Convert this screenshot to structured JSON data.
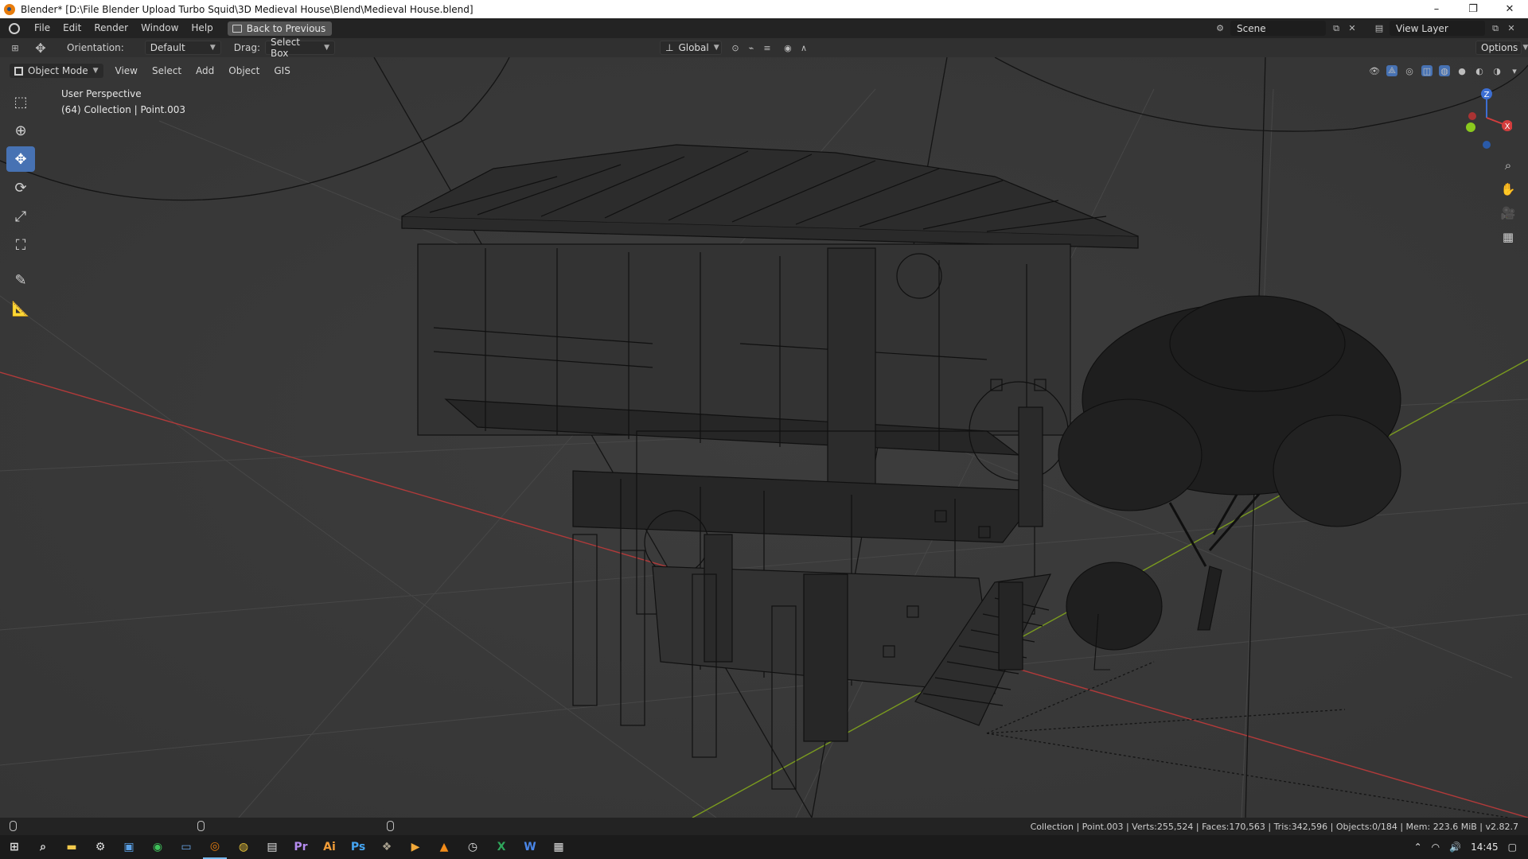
{
  "window": {
    "title": "Blender* [D:\\File Blender Upload Turbo Squid\\3D Medieval House\\Blend\\Medieval House.blend]",
    "minimize": "–",
    "maximize": "❐",
    "close": "✕"
  },
  "menu": {
    "items": [
      "File",
      "Edit",
      "Render",
      "Window",
      "Help"
    ],
    "back_button": "Back to Previous"
  },
  "scene": {
    "name": "Scene",
    "view_layer": "View Layer"
  },
  "tool_header": {
    "orientation_label": "Orientation:",
    "orientation_value": "Default",
    "drag_label": "Drag:",
    "drag_value": "Select Box",
    "transform_orientation": "Global",
    "options": "Options"
  },
  "view_header": {
    "mode": "Object Mode",
    "menus": [
      "View",
      "Select",
      "Add",
      "Object",
      "GIS"
    ]
  },
  "viewport": {
    "perspective": "User Perspective",
    "collection_info": "(64) Collection | Point.003",
    "axis_x": "X",
    "axis_y": "Y",
    "axis_z": "Z"
  },
  "status": {
    "text": "Collection | Point.003 | Verts:255,524 | Faces:170,563 | Tris:342,596 | Objects:0/184 | Mem: 223.6 MiB | v2.82.7"
  },
  "taskbar": {
    "apps": [
      "start-icon",
      "search-icon",
      "file-explorer-icon",
      "settings-icon",
      "calculator-icon",
      "whatsapp-icon",
      "taskview-icon",
      "blender-icon",
      "chrome-icon",
      "terminal-icon",
      "premiere-icon",
      "illustrator-icon",
      "photoshop-icon",
      "gimp-icon",
      "media-icon",
      "vlc-icon",
      "clock-icon",
      "excel-icon",
      "word-icon",
      "network-icon"
    ],
    "labels": {
      "premiere": "Pr",
      "illustrator": "Ai",
      "photoshop": "Ps",
      "excel": "X",
      "word": "W"
    },
    "time": "14:45"
  },
  "colors": {
    "accent": "#4772b3",
    "x_axis": "#b13a3a",
    "y_axis": "#7a9a1f",
    "wire": "#111111"
  }
}
